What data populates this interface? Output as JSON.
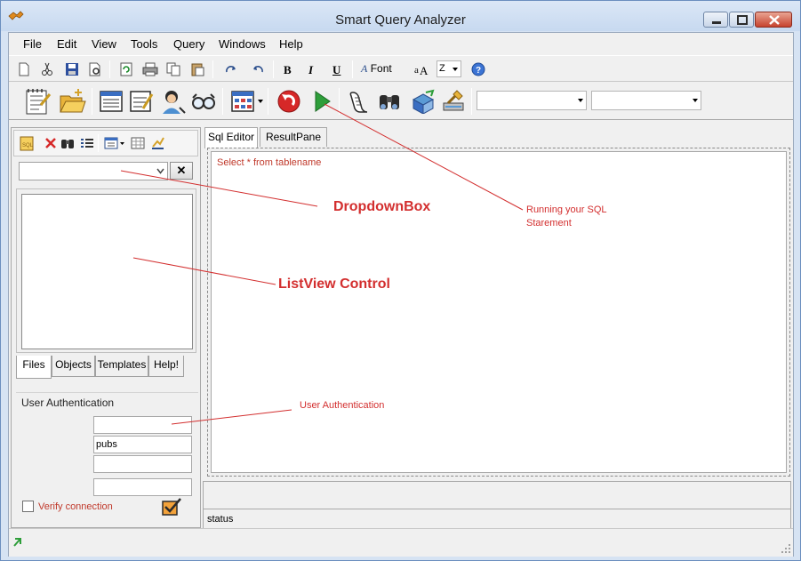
{
  "window": {
    "title": "Smart Query Analyzer"
  },
  "menu": [
    "File",
    "Edit",
    "View",
    "Tools",
    "Query",
    "Windows",
    "Help"
  ],
  "toolbar": {
    "font_label": "Font",
    "size_value": "Z"
  },
  "left_panel": {
    "tabs": [
      "Files",
      "Objects",
      "Templates",
      "Help!"
    ],
    "clear_button": "✕",
    "auth": {
      "legend": "User Authentication",
      "fields": [
        "",
        "pubs",
        "",
        ""
      ],
      "verify_label": "Verify connection"
    }
  },
  "editor": {
    "tabs": [
      "Sql Editor",
      "ResultPane"
    ],
    "text": "Select * from tablename"
  },
  "status": {
    "text": "status"
  },
  "annotations": {
    "dropdown": "DropdownBox",
    "listview": "ListView Control",
    "run_line1": "Running your SQL",
    "run_line2": "Starement",
    "auth": "User Authentication"
  },
  "colors": {
    "annotation": "#d32f2f",
    "run_green": "#2e9e3a",
    "stop_red": "#d62828"
  }
}
